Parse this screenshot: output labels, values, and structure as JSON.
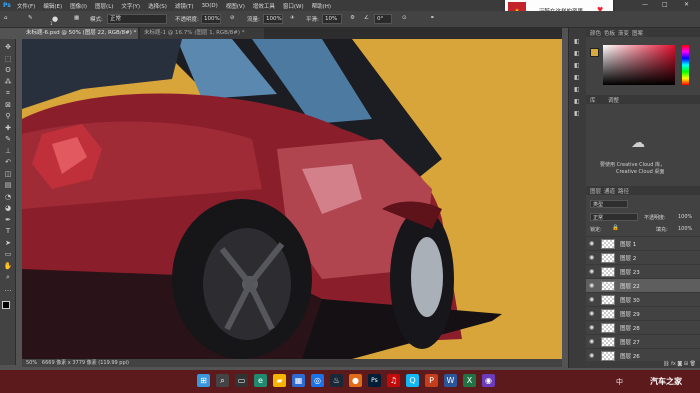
{
  "menu": [
    "文件(F)",
    "编辑(E)",
    "图像(I)",
    "图层(L)",
    "文字(Y)",
    "选择(S)",
    "滤镜(T)",
    "3D(D)",
    "视图(V)",
    "增效工具",
    "窗口(W)",
    "帮助(H)"
  ],
  "options": {
    "brush_size": "1",
    "mode_label": "模式:",
    "mode_value": "正常",
    "opacity_label": "不透明度:",
    "opacity_value": "100%",
    "flow_label": "流量:",
    "flow_value": "100%",
    "smooth_label": "平滑:",
    "smooth_value": "10%",
    "angle_value": "0°"
  },
  "tabs": [
    {
      "label": "未标题-6.psd @ 50% (图层 22, RGB/8#) *",
      "active": true
    },
    {
      "label": "未标题-1 @ 16.7% (图层 1, RGB/8#) *",
      "active": false
    }
  ],
  "status": {
    "zoom": "50%",
    "doc": "6669 像素 x 3779 像素 (119.99 ppi)"
  },
  "notification": {
    "text": "沉醉在这样的夜里"
  },
  "panel": {
    "color_tabs": [
      "颜色",
      "色板",
      "渐变",
      "图案"
    ],
    "lib_tabs": [
      "库",
      "调整"
    ],
    "cc_text": "要使用 Creative Cloud 库，",
    "cc_text2": "Creative Cloud 桌面"
  },
  "layers_panel": {
    "tabs": [
      "图层",
      "通道",
      "路径"
    ],
    "kind": "类型",
    "blend": "正常",
    "opacity_label": "不透明度:",
    "opacity_value": "100%",
    "lock_label": "锁定:",
    "fill_label": "填充:",
    "fill_value": "100%",
    "layers": [
      "图层 1",
      "图层 2",
      "图层 23",
      "图层 22",
      "图层 30",
      "图层 29",
      "图层 28",
      "图层 27",
      "图层 26"
    ],
    "selected": 3
  },
  "taskbar": {
    "icons": [
      "windows-icon",
      "search-icon",
      "task-view-icon",
      "edge-icon",
      "explorer-icon",
      "store-icon",
      "lens-icon",
      "steam-icon",
      "app-icon",
      "photoshop-icon",
      "netease-icon",
      "qq-icon",
      "powerpoint-icon",
      "word-icon",
      "excel-icon",
      "obs-icon"
    ],
    "ime": "中",
    "watermark": "汽车之家"
  },
  "colors": {
    "canvas_bg": "#d8a53a",
    "car_red": "#8b1e2b",
    "taskbar": "#5c1a1d"
  }
}
